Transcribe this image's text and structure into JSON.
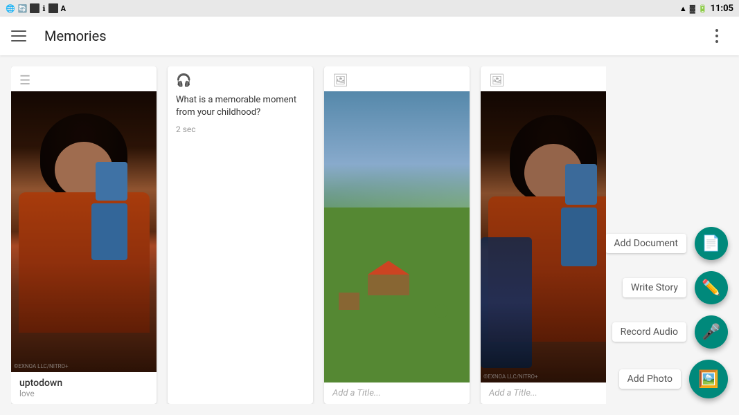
{
  "statusBar": {
    "time": "11:05",
    "icons": [
      "wifi",
      "signal",
      "battery"
    ]
  },
  "appBar": {
    "title": "Memories",
    "menuIcon": "hamburger",
    "overflowIcon": "more-vertical"
  },
  "cards": [
    {
      "id": "card-1",
      "type": "image",
      "typeIcon": "text-icon",
      "name": "uptodown",
      "subtitle": "love",
      "hasCharacterArt": true,
      "overlayDim": true
    },
    {
      "id": "card-2",
      "type": "audio",
      "typeIcon": "headphone-icon",
      "question": "What is a memorable moment from your childhood?",
      "duration": "2 sec"
    },
    {
      "id": "card-3",
      "type": "image",
      "typeIcon": "image-icon",
      "addTitlePlaceholder": "Add a Title...",
      "hasGameArt": true
    },
    {
      "id": "card-4",
      "type": "image",
      "typeIcon": "image-icon",
      "addTitlePlaceholder": "Add a Title...",
      "hasCharacterArt": true,
      "overlayDim": true
    }
  ],
  "fabActions": [
    {
      "id": "add-document",
      "label": "Add Document",
      "icon": "document-icon",
      "iconChar": "📄"
    },
    {
      "id": "write-story",
      "label": "Write Story",
      "icon": "story-icon",
      "iconChar": "✏️"
    },
    {
      "id": "record-audio",
      "label": "Record Audio",
      "icon": "microphone-icon",
      "iconChar": "🎤"
    },
    {
      "id": "add-photo",
      "label": "Add Photo",
      "icon": "photo-icon",
      "iconChar": "🖼️"
    }
  ]
}
